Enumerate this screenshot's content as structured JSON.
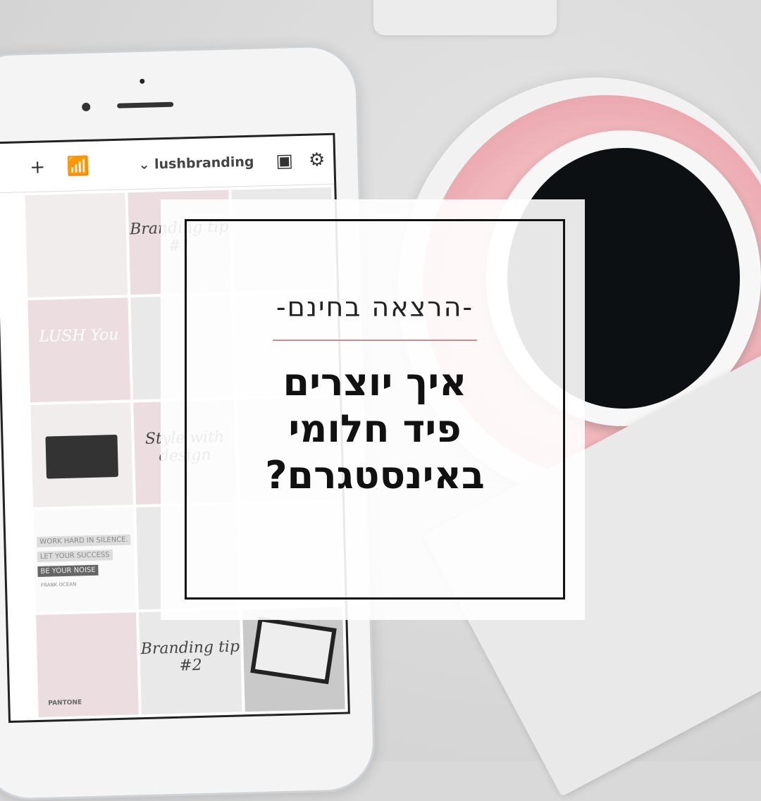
{
  "phone_app": {
    "account": "lushbranding",
    "icons": [
      "plus-icon",
      "bar-chart-icon",
      "chevron-down-icon",
      "calendar-icon",
      "gear-icon"
    ],
    "tiles": {
      "branding_tip_1": "Branding tip #1",
      "lush_you": "LUSH You",
      "style_with_design": "Style with design",
      "quote_lines": [
        "WORK HARD IN SILENCE.",
        "LET YOUR SUCCESS",
        "BE YOUR NOISE"
      ],
      "quote_author": "FRANK OCEAN",
      "pantone": "PANTONE",
      "branding_tip_2": "Branding tip #2"
    }
  },
  "card": {
    "subtitle": "-הרצאה בחינם-",
    "title_lines": [
      "איך יוצרים",
      "פיד חלומי",
      "באינסטגרם?"
    ],
    "accent_color": "#c98d8e"
  }
}
